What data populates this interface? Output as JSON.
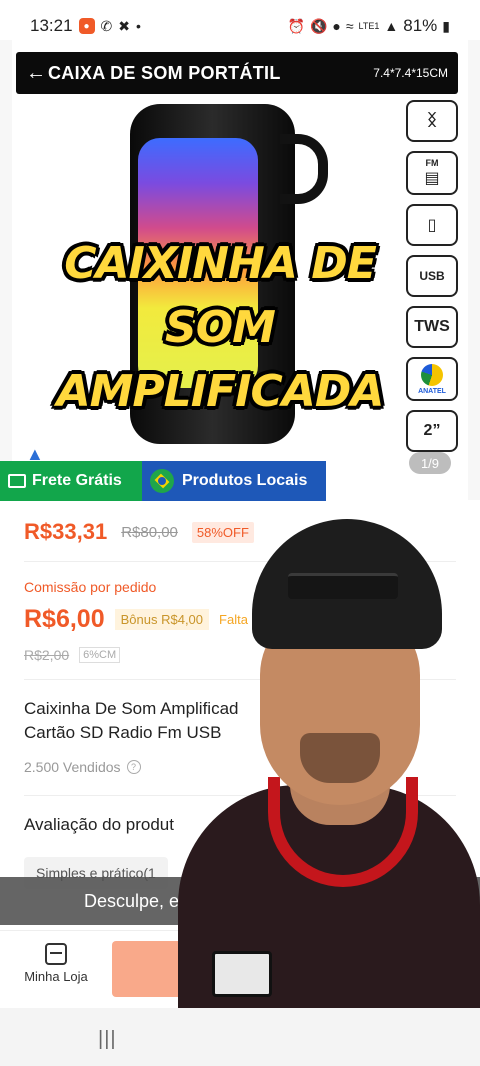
{
  "status_bar": {
    "time": "13:21",
    "battery": "81%",
    "network": "LTE1"
  },
  "product_image": {
    "heading": "CAIXA DE SOM PORTÁTIL",
    "dimensions": "7.4*7.4*15CM",
    "caption_lines": [
      "CAIXINHA DE",
      "SOM",
      "AMPLIFICADA"
    ],
    "features": [
      "bluetooth-icon",
      "fm-radio-icon",
      "sd-card-icon",
      "USB",
      "TWS",
      "ANATEL",
      "2”"
    ],
    "anatel_label": "ANATEL",
    "usb_label": "USB",
    "tws_label": "TWS",
    "size_label": "2”",
    "fm_label": "FM",
    "page_counter": "1/9"
  },
  "badges": {
    "free_shipping": "Frete Grátis",
    "local_products": "Produtos Locais"
  },
  "pricing": {
    "price": "R$33,31",
    "original_price": "R$80,00",
    "discount": "58%OFF",
    "commission_label": "Comissão por pedido",
    "commission_value": "R$6,00",
    "bonus": "Bônus R$4,00",
    "extra_label": "Falta",
    "old_commission": "R$2,00",
    "old_percent": "6%CM"
  },
  "product": {
    "name": "Caixinha De Som Amplificad... Cartão SD Radio Fm USB",
    "name_line1": "Caixinha De Som Amplificad",
    "name_line2": "Cartão SD Radio Fm USB",
    "sold": "2.500 Vendidos",
    "rating_title": "Avaliação do produt",
    "review_chip": "Simples e prático(1"
  },
  "toast": {
    "message": "Desculpe, e"
  },
  "bottom_bar": {
    "store_label": "Minha Loja"
  },
  "nav": {
    "recents": "|||"
  },
  "colors": {
    "accent": "#f05a28",
    "green_badge": "#12a64b",
    "blue_badge": "#1e58b8",
    "caption_yellow": "#ffd83d"
  }
}
